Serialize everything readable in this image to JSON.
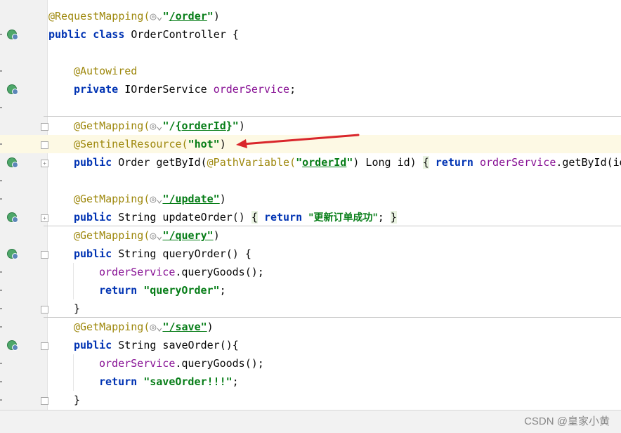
{
  "editor": {
    "lines": {
      "l1": {
        "ann": "@RequestMapping(",
        "close": ")",
        "path": "/order"
      },
      "l2": {
        "kw1": "public",
        "kw2": "class",
        "name": "OrderController {"
      },
      "l4": {
        "ann": "@Autowired"
      },
      "l5": {
        "kw": "private",
        "type": "IOrderService ",
        "field": "orderService",
        "end": ";"
      },
      "l7": {
        "ann": "@GetMapping(",
        "q1": "\"/{",
        "path": "orderId",
        "q2": "}\"",
        "close": ")"
      },
      "l8": {
        "ann": "@SentinelResource(",
        "str": "\"hot\"",
        "close": ")"
      },
      "l9": {
        "kw": "public",
        "sig": " Order getById(",
        "ann": "@PathVariable(",
        "str_q1": "\"",
        "path": "orderId",
        "str_q2": "\"",
        "rest": ") Long id) ",
        "brace": "{",
        "kw2": "return",
        "field": "orderService",
        "call": ".getById(id"
      },
      "l11": {
        "ann": "@GetMapping(",
        "path": "\"/update\"",
        "close": ")"
      },
      "l12": {
        "kw": "public",
        "sig": " String updateOrder() ",
        "brace": "{",
        "kw2": "return",
        "str": "\"更新订单成功\"",
        "end": "; ",
        "brace2": "}"
      },
      "l13": {
        "ann": "@GetMapping(",
        "path": "\"/query\"",
        "close": ")"
      },
      "l14": {
        "kw": "public",
        "sig": " String queryOrder() {"
      },
      "l15": {
        "field": "orderService",
        "call": ".queryGoods();"
      },
      "l16": {
        "kw": "return",
        "str": "\"queryOrder\"",
        "end": ";"
      },
      "l17": {
        "brace": "}"
      },
      "l18": {
        "ann": "@GetMapping(",
        "path": "\"/save\"",
        "close": ")"
      },
      "l19": {
        "kw": "public",
        "sig": " String saveOrder(){"
      },
      "l20": {
        "field": "orderService",
        "call": ".queryGoods();"
      },
      "l21": {
        "kw": "return",
        "str": "\"saveOrder!!!\"",
        "end": ";"
      },
      "l22": {
        "brace": "}"
      }
    },
    "web_icon": "globe-icon",
    "web_arrow": "⌄"
  },
  "annotation": {
    "arrow_color": "#d9262b"
  },
  "watermark": "CSDN @皇家小黄",
  "colors": {
    "keyword": "#0033b3",
    "annotation": "#9e880d",
    "string": "#067d17",
    "field": "#871094"
  }
}
